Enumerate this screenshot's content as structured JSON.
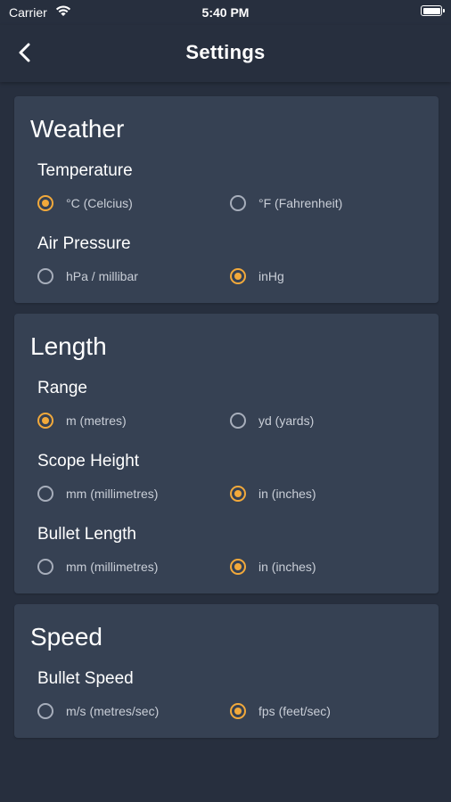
{
  "status": {
    "carrier": "Carrier",
    "time": "5:40 PM"
  },
  "nav": {
    "title": "Settings"
  },
  "colors": {
    "background": "#272f3e",
    "card": "#364153",
    "accent": "#f2a93b",
    "radio_border": "#a7aebb"
  },
  "sections": [
    {
      "title": "Weather",
      "groups": [
        {
          "label": "Temperature",
          "options": [
            {
              "label": "°C (Celcius)",
              "selected": true
            },
            {
              "label": "°F (Fahrenheit)",
              "selected": false
            }
          ]
        },
        {
          "label": "Air Pressure",
          "options": [
            {
              "label": "hPa / millibar",
              "selected": false
            },
            {
              "label": "inHg",
              "selected": true
            }
          ]
        }
      ]
    },
    {
      "title": "Length",
      "groups": [
        {
          "label": "Range",
          "options": [
            {
              "label": "m (metres)",
              "selected": true
            },
            {
              "label": "yd (yards)",
              "selected": false
            }
          ]
        },
        {
          "label": "Scope Height",
          "options": [
            {
              "label": "mm (millimetres)",
              "selected": false
            },
            {
              "label": "in (inches)",
              "selected": true
            }
          ]
        },
        {
          "label": "Bullet Length",
          "options": [
            {
              "label": "mm (millimetres)",
              "selected": false
            },
            {
              "label": "in (inches)",
              "selected": true
            }
          ]
        }
      ]
    },
    {
      "title": "Speed",
      "groups": [
        {
          "label": "Bullet Speed",
          "options": [
            {
              "label": "m/s (metres/sec)",
              "selected": false
            },
            {
              "label": "fps (feet/sec)",
              "selected": true
            }
          ]
        }
      ]
    }
  ]
}
